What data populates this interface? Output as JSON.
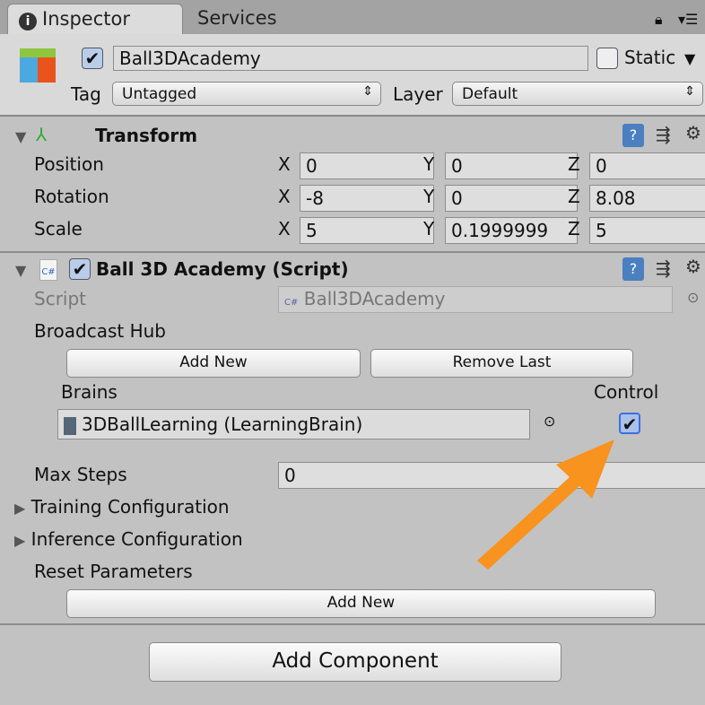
{
  "tabs": [
    "Inspector",
    "Services"
  ],
  "object": {
    "active": true,
    "name": "Ball3DAcademy",
    "static_label": "Static",
    "static": false,
    "tag_label": "Tag",
    "tag": "Untagged",
    "layer_label": "Layer",
    "layer": "Default"
  },
  "transform": {
    "title": "Transform",
    "rows": [
      {
        "label": "Position",
        "x": "0",
        "y": "0",
        "z": "0"
      },
      {
        "label": "Rotation",
        "x": "-8",
        "y": "0",
        "z": "8.08"
      },
      {
        "label": "Scale",
        "x": "5",
        "y": "0.1999999",
        "z": "5"
      }
    ],
    "axes": [
      "X",
      "Y",
      "Z"
    ]
  },
  "academy": {
    "title": "Ball 3D Academy (Script)",
    "enabled": true,
    "script_label": "Script",
    "script": "Ball3DAcademy",
    "broadcast_hub": "Broadcast Hub",
    "add_new": "Add New",
    "remove_last": "Remove Last",
    "brains_label": "Brains",
    "control_label": "Control",
    "brain": "3DBallLearning (LearningBrain)",
    "control": true,
    "max_steps_label": "Max Steps",
    "max_steps": "0",
    "training": "Training Configuration",
    "inference": "Inference Configuration",
    "reset_params": "Reset Parameters",
    "reset_add_new": "Add New",
    "cs": "C#"
  },
  "add_component": "Add Component",
  "colors": {
    "arrow": "#f7931e",
    "checkbox_focus": "#3d6fe0"
  }
}
